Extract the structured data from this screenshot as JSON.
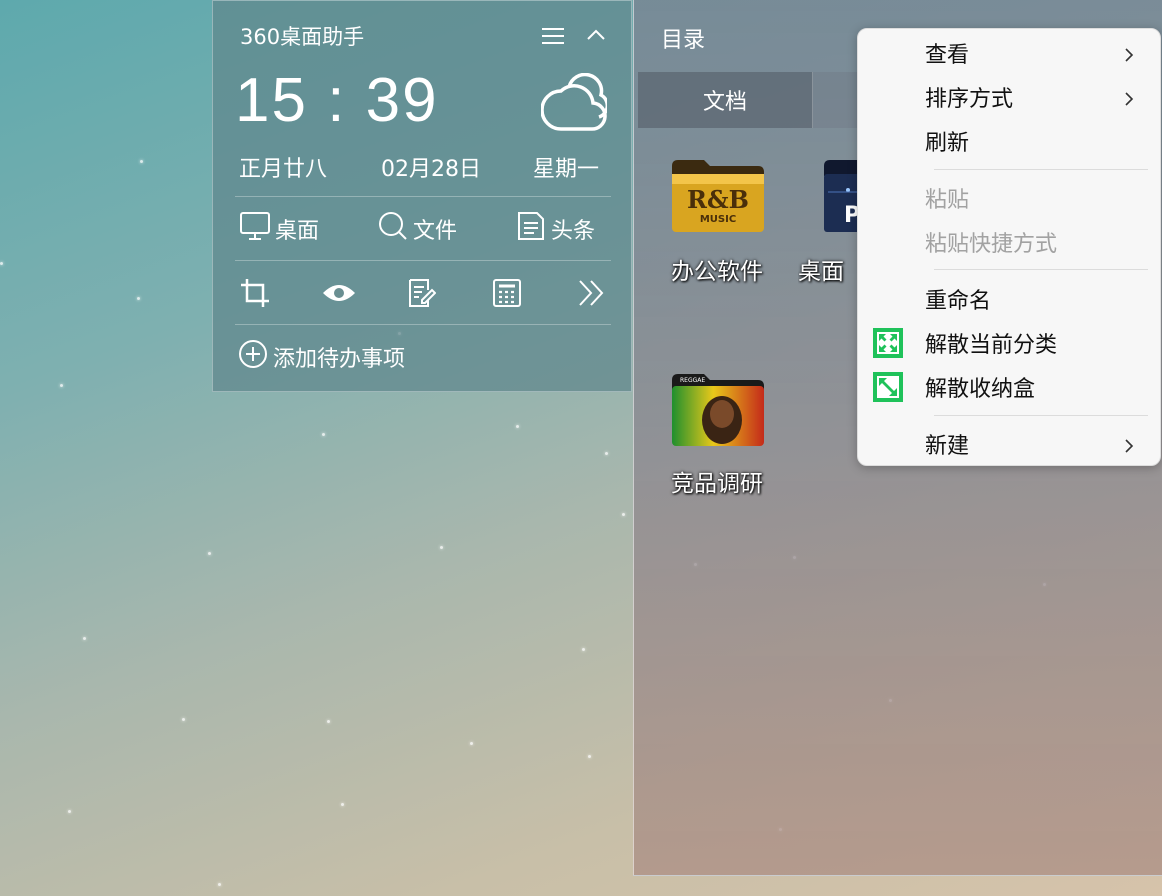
{
  "widget": {
    "title": "360桌面助手",
    "time": "15 : 39",
    "lunar_date": "正月廿八",
    "date": "02月28日",
    "weekday": "星期一",
    "links": [
      {
        "label": "桌面",
        "icon": "monitor-icon"
      },
      {
        "label": "文件",
        "icon": "search-icon"
      },
      {
        "label": "头条",
        "icon": "news-icon"
      }
    ],
    "tools": [
      "crop-icon",
      "eye-icon",
      "note-edit-icon",
      "calculator-icon",
      "double-chevron-right-icon"
    ],
    "todo_label": "添加待办事项"
  },
  "box": {
    "title": "目录",
    "tabs": [
      {
        "label": "文档"
      }
    ],
    "items": [
      {
        "label": "办公软件",
        "icon": "rnb-music-folder-icon"
      },
      {
        "label": "桌面",
        "icon": "dark-folder-icon"
      },
      {
        "label": "竞品调研",
        "icon": "reggae-folder-icon"
      }
    ]
  },
  "context_menu": {
    "items": [
      {
        "label": "查看",
        "submenu": true,
        "enabled": true
      },
      {
        "label": "排序方式",
        "submenu": true,
        "enabled": true
      },
      {
        "label": "刷新",
        "submenu": false,
        "enabled": true
      },
      {
        "label": "粘贴",
        "submenu": false,
        "enabled": false
      },
      {
        "label": "粘贴快捷方式",
        "submenu": false,
        "enabled": false
      },
      {
        "label": "重命名",
        "submenu": false,
        "enabled": true
      },
      {
        "label": "解散当前分类",
        "submenu": false,
        "enabled": true,
        "icon": "dissolve-category-icon"
      },
      {
        "label": "解散收纳盒",
        "submenu": false,
        "enabled": true,
        "icon": "dissolve-box-icon"
      },
      {
        "label": "新建",
        "submenu": true,
        "enabled": true
      }
    ],
    "icon_color": "#1fc25a"
  }
}
